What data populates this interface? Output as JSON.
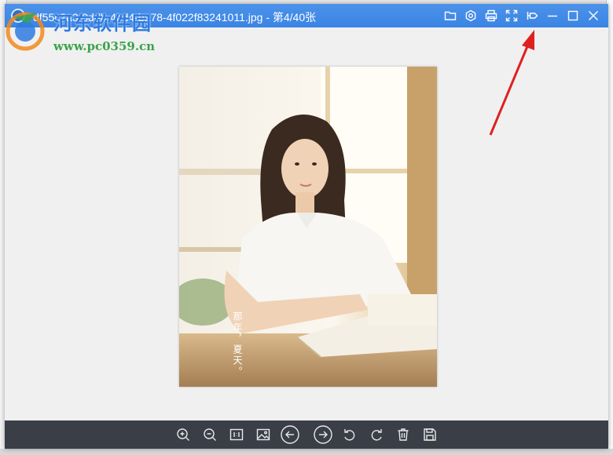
{
  "window": {
    "title": "df55c2a3-8ddb-4bd4-ba78-4f022f83241011.jpg - 第4/40张"
  },
  "titlebar": {
    "icons": [
      "folder-icon",
      "settings-icon",
      "print-icon",
      "fullscreen-icon",
      "pin-icon",
      "minimize-icon",
      "maximize-icon",
      "close-icon"
    ]
  },
  "watermark": {
    "title": "河东软件园",
    "url": "www.pc0359.cn"
  },
  "photo": {
    "caption": "那年，夏天。"
  },
  "toolbar": {
    "icons": [
      "zoom-in-icon",
      "zoom-out-icon",
      "actual-size-icon",
      "fit-image-icon",
      "previous-icon",
      "next-icon",
      "rotate-left-icon",
      "rotate-right-icon",
      "delete-icon",
      "save-icon"
    ]
  },
  "colors": {
    "titlebar": "#3a84e4",
    "toolbar": "#3a3e47",
    "canvas": "#f0f0f0",
    "annotation": "#e02020"
  }
}
